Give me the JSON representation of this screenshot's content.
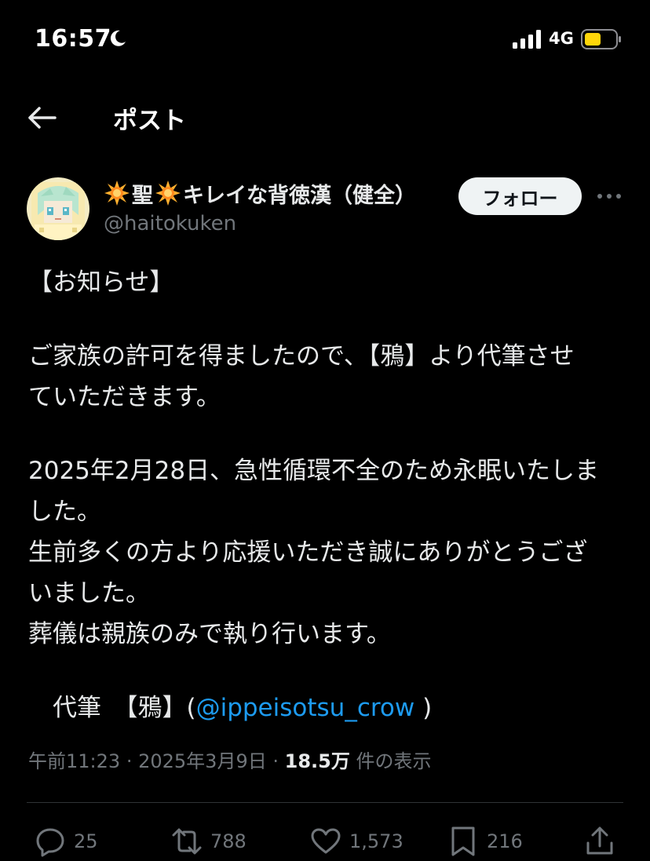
{
  "status_bar": {
    "time": "16:57",
    "network": "4G",
    "icons": [
      "moon-icon",
      "signal-icon",
      "battery-icon"
    ]
  },
  "nav": {
    "title": "ポスト",
    "back_icon": "arrow-left-icon"
  },
  "author": {
    "name_parts": [
      "聖",
      "キレイな背徳漢（健全）"
    ],
    "name_icon": "sun-emoji-icon",
    "handle": "@haitokuken",
    "follow_label": "フォロー",
    "more_icon": "more-dots-icon"
  },
  "post": {
    "lines": [
      "【お知らせ】",
      "",
      "ご家族の許可を得ましたので、【鴉】より代筆させ",
      "ていただきます。",
      "",
      "2025年2月28日、急性循環不全のため永眠いたしま",
      "した。",
      "生前多くの方より応援いただき誠にありがとうござ",
      "いました。",
      "葬儀は親族のみで執り行います。",
      ""
    ],
    "signature_prefix": "　代筆　【鴉】(",
    "signature_mention": "@ippeisotsu_crow",
    "signature_suffix": " )"
  },
  "meta": {
    "time": "午前11:23",
    "separator": "·",
    "date": "2025年3月9日",
    "views": "18.5万",
    "views_label": " 件の表示"
  },
  "actions": {
    "replies": "25",
    "reposts": "788",
    "likes": "1,573",
    "bookmarks": "216"
  },
  "colors": {
    "background": "#000000",
    "text": "#e7e9ea",
    "secondary": "#71767b",
    "link": "#1d9bf0",
    "follow_bg": "#eff3f4",
    "battery": "#ffd60a"
  }
}
